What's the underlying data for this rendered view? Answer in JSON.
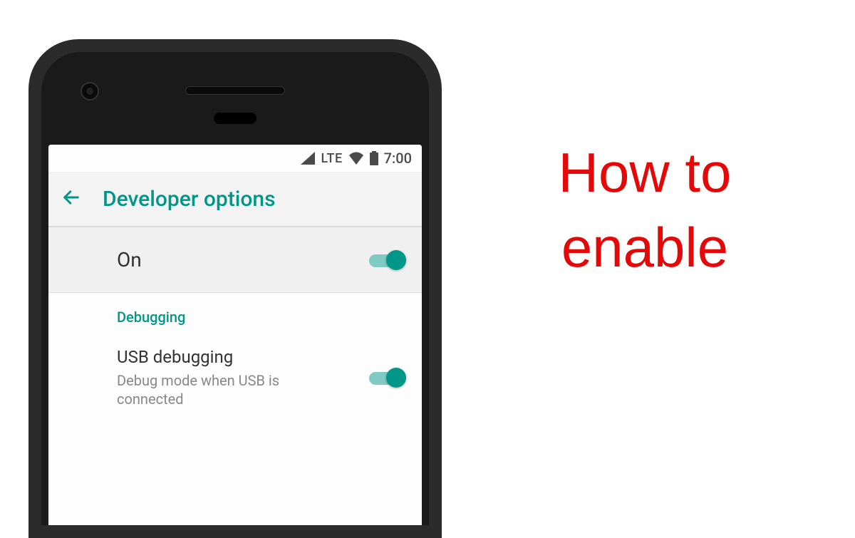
{
  "statusbar": {
    "network_label": "LTE",
    "time": "7:00"
  },
  "appbar": {
    "title": "Developer options"
  },
  "master_toggle": {
    "label": "On",
    "enabled": true
  },
  "sections": {
    "debugging_header": "Debugging"
  },
  "usb_debugging": {
    "title": "USB debugging",
    "subtitle": "Debug mode when USB is connected",
    "enabled": true
  },
  "hero": {
    "line1": "How  to",
    "line2": "enable"
  },
  "colors": {
    "accent": "#009688",
    "hero": "#e40808"
  }
}
